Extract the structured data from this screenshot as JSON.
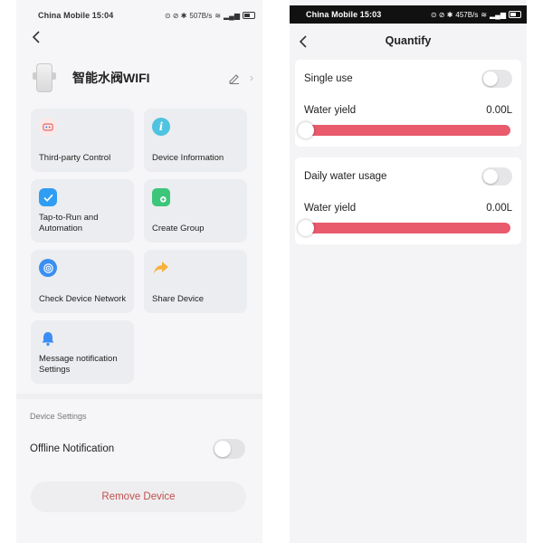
{
  "left": {
    "status": {
      "carrier": "China Mobile 15:04",
      "speed": "507B/s"
    },
    "device_name": "智能水阀WIFI",
    "tiles": [
      {
        "label": "Third-party Control",
        "icon": "third-party-control-icon",
        "color": "#e86a6a"
      },
      {
        "label": "Device Information",
        "icon": "info-icon",
        "color": "#4fc3e0"
      },
      {
        "label": "Tap-to-Run and Automation",
        "icon": "automation-check-icon",
        "color": "#2f9df4"
      },
      {
        "label": "Create Group",
        "icon": "create-group-icon",
        "color": "#3cc67a"
      },
      {
        "label": "Check Device Network",
        "icon": "network-check-icon",
        "color": "#3b8ff0"
      },
      {
        "label": "Share Device",
        "icon": "share-arrow-icon",
        "color": "#f5b23c"
      },
      {
        "label": "Message notification Settings",
        "icon": "bell-icon",
        "color": "#3d8df5"
      }
    ],
    "section_title": "Device Settings",
    "offline_notification": {
      "label": "Offline Notification",
      "enabled": false
    },
    "remove_label": "Remove Device",
    "remove_color": "#c0504d"
  },
  "right": {
    "status": {
      "carrier": "China Mobile 15:03",
      "speed": "457B/s"
    },
    "title": "Quantify",
    "cards": [
      {
        "toggle_label": "Single use",
        "enabled": false,
        "yield_label": "Water yield",
        "value": "0.00L",
        "fill": 0
      },
      {
        "toggle_label": "Daily water usage",
        "enabled": false,
        "yield_label": "Water yield",
        "value": "0.00L",
        "fill": 0
      }
    ],
    "slider_color": "#e95a6c"
  }
}
